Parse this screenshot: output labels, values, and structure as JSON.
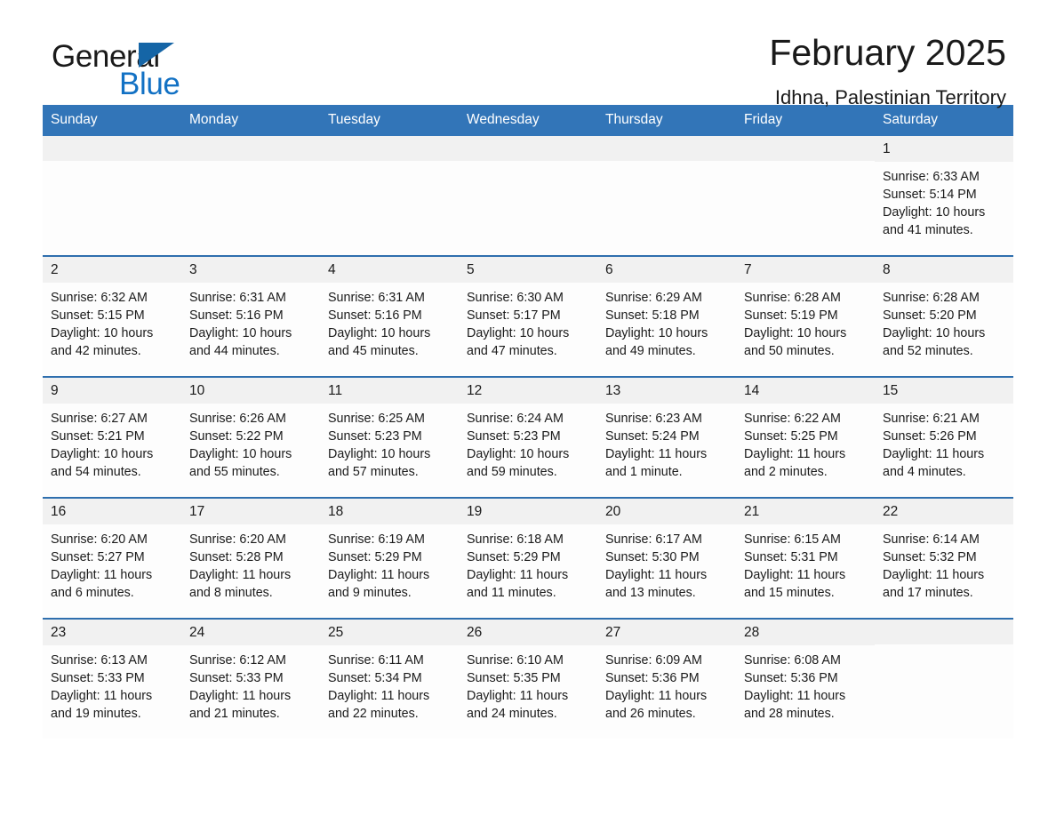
{
  "brand": {
    "word_one": "General",
    "word_two": "Blue",
    "flag_color": "#1565a6",
    "blue_color": "#1271c4"
  },
  "header": {
    "month_title": "February 2025",
    "location": "Idhna, Palestinian Territory"
  },
  "theme": {
    "header_bg": "#3275b8",
    "row_rule": "#2f6fae",
    "daynum_bg": "#f1f1f1"
  },
  "weekdays": [
    "Sunday",
    "Monday",
    "Tuesday",
    "Wednesday",
    "Thursday",
    "Friday",
    "Saturday"
  ],
  "weeks": [
    [
      {
        "day": "",
        "empty": true
      },
      {
        "day": "",
        "empty": true
      },
      {
        "day": "",
        "empty": true
      },
      {
        "day": "",
        "empty": true
      },
      {
        "day": "",
        "empty": true
      },
      {
        "day": "",
        "empty": true
      },
      {
        "day": "1",
        "sunrise": "Sunrise: 6:33 AM",
        "sunset": "Sunset: 5:14 PM",
        "daylight": "Daylight: 10 hours and 41 minutes."
      }
    ],
    [
      {
        "day": "2",
        "sunrise": "Sunrise: 6:32 AM",
        "sunset": "Sunset: 5:15 PM",
        "daylight": "Daylight: 10 hours and 42 minutes."
      },
      {
        "day": "3",
        "sunrise": "Sunrise: 6:31 AM",
        "sunset": "Sunset: 5:16 PM",
        "daylight": "Daylight: 10 hours and 44 minutes."
      },
      {
        "day": "4",
        "sunrise": "Sunrise: 6:31 AM",
        "sunset": "Sunset: 5:16 PM",
        "daylight": "Daylight: 10 hours and 45 minutes."
      },
      {
        "day": "5",
        "sunrise": "Sunrise: 6:30 AM",
        "sunset": "Sunset: 5:17 PM",
        "daylight": "Daylight: 10 hours and 47 minutes."
      },
      {
        "day": "6",
        "sunrise": "Sunrise: 6:29 AM",
        "sunset": "Sunset: 5:18 PM",
        "daylight": "Daylight: 10 hours and 49 minutes."
      },
      {
        "day": "7",
        "sunrise": "Sunrise: 6:28 AM",
        "sunset": "Sunset: 5:19 PM",
        "daylight": "Daylight: 10 hours and 50 minutes."
      },
      {
        "day": "8",
        "sunrise": "Sunrise: 6:28 AM",
        "sunset": "Sunset: 5:20 PM",
        "daylight": "Daylight: 10 hours and 52 minutes."
      }
    ],
    [
      {
        "day": "9",
        "sunrise": "Sunrise: 6:27 AM",
        "sunset": "Sunset: 5:21 PM",
        "daylight": "Daylight: 10 hours and 54 minutes."
      },
      {
        "day": "10",
        "sunrise": "Sunrise: 6:26 AM",
        "sunset": "Sunset: 5:22 PM",
        "daylight": "Daylight: 10 hours and 55 minutes."
      },
      {
        "day": "11",
        "sunrise": "Sunrise: 6:25 AM",
        "sunset": "Sunset: 5:23 PM",
        "daylight": "Daylight: 10 hours and 57 minutes."
      },
      {
        "day": "12",
        "sunrise": "Sunrise: 6:24 AM",
        "sunset": "Sunset: 5:23 PM",
        "daylight": "Daylight: 10 hours and 59 minutes."
      },
      {
        "day": "13",
        "sunrise": "Sunrise: 6:23 AM",
        "sunset": "Sunset: 5:24 PM",
        "daylight": "Daylight: 11 hours and 1 minute."
      },
      {
        "day": "14",
        "sunrise": "Sunrise: 6:22 AM",
        "sunset": "Sunset: 5:25 PM",
        "daylight": "Daylight: 11 hours and 2 minutes."
      },
      {
        "day": "15",
        "sunrise": "Sunrise: 6:21 AM",
        "sunset": "Sunset: 5:26 PM",
        "daylight": "Daylight: 11 hours and 4 minutes."
      }
    ],
    [
      {
        "day": "16",
        "sunrise": "Sunrise: 6:20 AM",
        "sunset": "Sunset: 5:27 PM",
        "daylight": "Daylight: 11 hours and 6 minutes."
      },
      {
        "day": "17",
        "sunrise": "Sunrise: 6:20 AM",
        "sunset": "Sunset: 5:28 PM",
        "daylight": "Daylight: 11 hours and 8 minutes."
      },
      {
        "day": "18",
        "sunrise": "Sunrise: 6:19 AM",
        "sunset": "Sunset: 5:29 PM",
        "daylight": "Daylight: 11 hours and 9 minutes."
      },
      {
        "day": "19",
        "sunrise": "Sunrise: 6:18 AM",
        "sunset": "Sunset: 5:29 PM",
        "daylight": "Daylight: 11 hours and 11 minutes."
      },
      {
        "day": "20",
        "sunrise": "Sunrise: 6:17 AM",
        "sunset": "Sunset: 5:30 PM",
        "daylight": "Daylight: 11 hours and 13 minutes."
      },
      {
        "day": "21",
        "sunrise": "Sunrise: 6:15 AM",
        "sunset": "Sunset: 5:31 PM",
        "daylight": "Daylight: 11 hours and 15 minutes."
      },
      {
        "day": "22",
        "sunrise": "Sunrise: 6:14 AM",
        "sunset": "Sunset: 5:32 PM",
        "daylight": "Daylight: 11 hours and 17 minutes."
      }
    ],
    [
      {
        "day": "23",
        "sunrise": "Sunrise: 6:13 AM",
        "sunset": "Sunset: 5:33 PM",
        "daylight": "Daylight: 11 hours and 19 minutes."
      },
      {
        "day": "24",
        "sunrise": "Sunrise: 6:12 AM",
        "sunset": "Sunset: 5:33 PM",
        "daylight": "Daylight: 11 hours and 21 minutes."
      },
      {
        "day": "25",
        "sunrise": "Sunrise: 6:11 AM",
        "sunset": "Sunset: 5:34 PM",
        "daylight": "Daylight: 11 hours and 22 minutes."
      },
      {
        "day": "26",
        "sunrise": "Sunrise: 6:10 AM",
        "sunset": "Sunset: 5:35 PM",
        "daylight": "Daylight: 11 hours and 24 minutes."
      },
      {
        "day": "27",
        "sunrise": "Sunrise: 6:09 AM",
        "sunset": "Sunset: 5:36 PM",
        "daylight": "Daylight: 11 hours and 26 minutes."
      },
      {
        "day": "28",
        "sunrise": "Sunrise: 6:08 AM",
        "sunset": "Sunset: 5:36 PM",
        "daylight": "Daylight: 11 hours and 28 minutes."
      },
      {
        "day": "",
        "empty": true
      }
    ]
  ]
}
